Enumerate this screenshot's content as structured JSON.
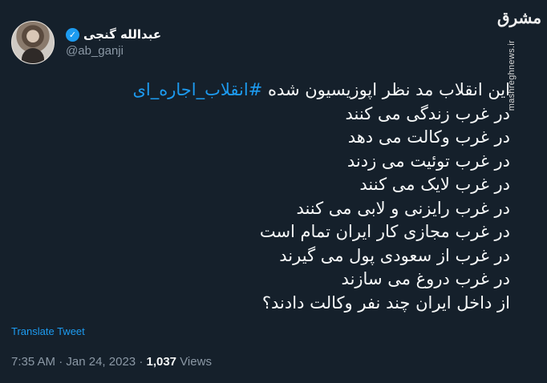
{
  "author": {
    "display_name": "عبدالله گنجی",
    "handle": "@ab_ganji",
    "verified_icon": "check-icon"
  },
  "watermark": {
    "logo": "مشرق",
    "url": "mashreghnews.ir"
  },
  "tweet": {
    "first_line_text": "این انقلاب مد نظر اپوزیسیون شده ",
    "hashtag": "#انقلاب_اجاره_ای",
    "lines": [
      "در غرب زندگی می کنند",
      "در غرب وکالت می دهد",
      "در غرب توئیت می زدند",
      "در غرب لایک می کنند",
      "در غرب رایزنی و لابی می کنند",
      "در غرب مجازی کار ایران تمام است",
      "در غرب از سعودی پول می گیرند",
      "در غرب دروغ می سازند",
      "از داخل ایران چند نفر وکالت دادند؟"
    ]
  },
  "translate_label": "Translate Tweet",
  "meta": {
    "time": "7:35 AM",
    "separator": "·",
    "date": "Jan 24, 2023",
    "views_count": "1,037",
    "views_label": "Views"
  },
  "colors": {
    "background": "#15202b",
    "text": "#f7f9f9",
    "accent": "#1d9bf0",
    "muted": "#8b98a5"
  }
}
